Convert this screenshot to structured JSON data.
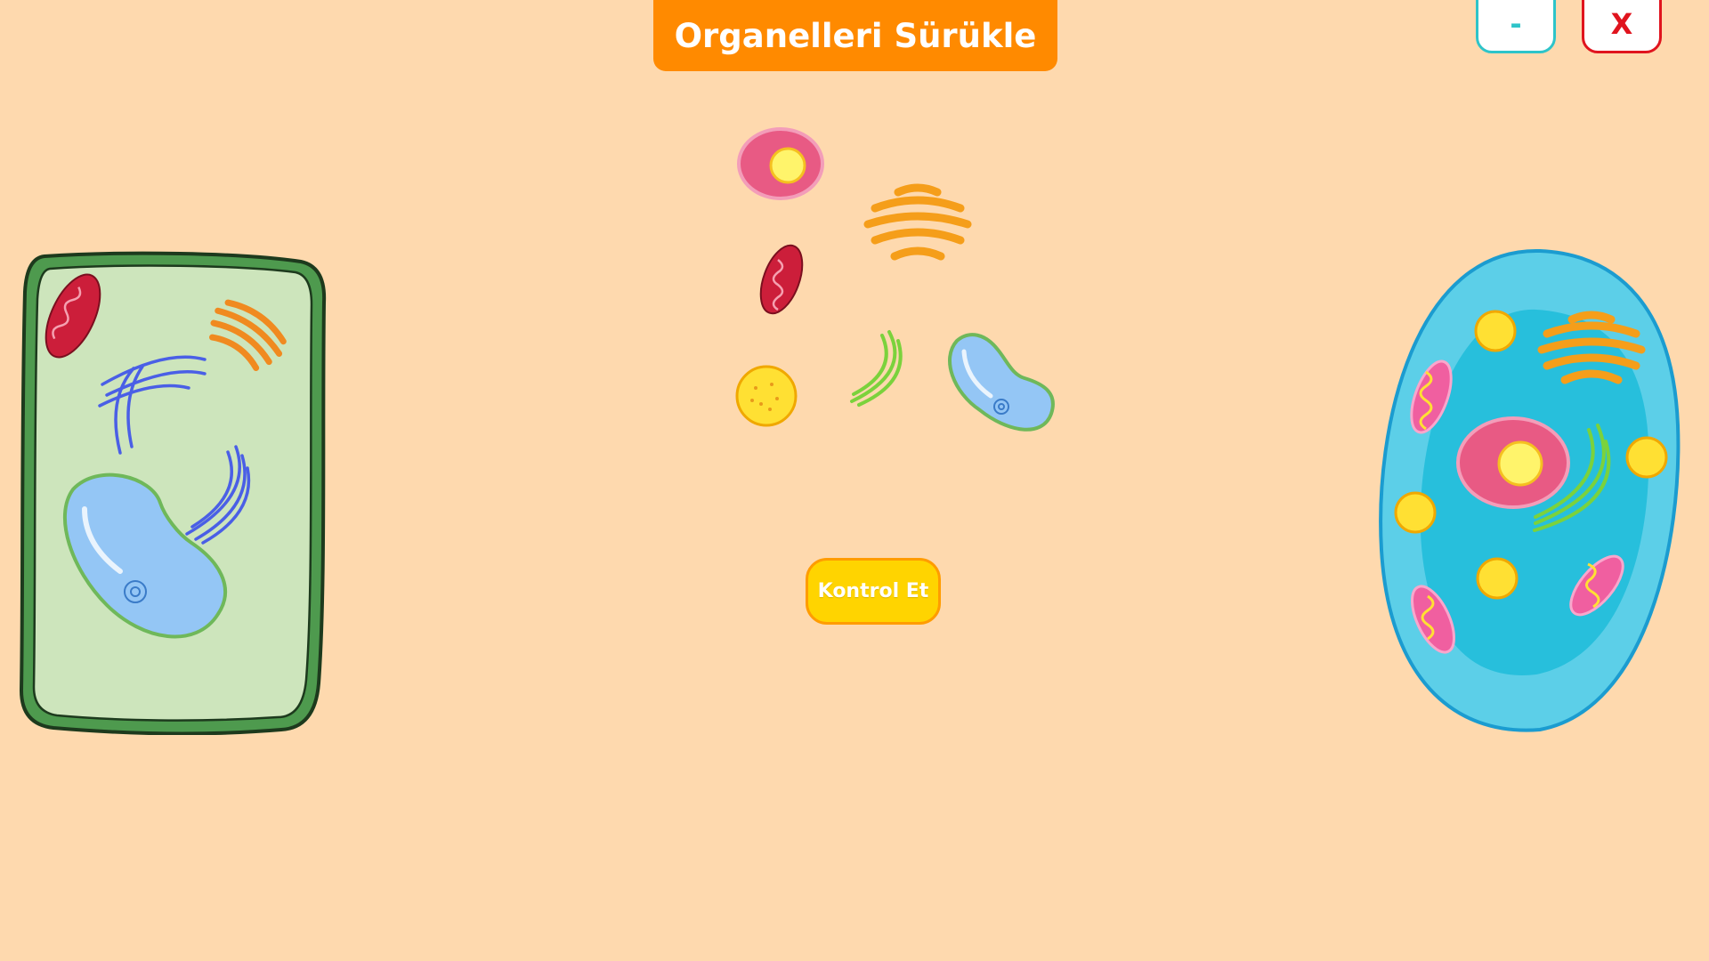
{
  "header": {
    "title": "Organelleri Sürükle"
  },
  "window_controls": {
    "minimize_label": "-",
    "close_label": "X"
  },
  "actions": {
    "check_label": "Kontrol Et"
  },
  "cells": {
    "left": "plant-cell",
    "right": "animal-cell"
  },
  "draggable_organelles": [
    "nucleus",
    "golgi-apparatus",
    "mitochondrion",
    "lysosome",
    "endoplasmic-reticulum",
    "vacuole"
  ],
  "colors": {
    "background": "#FED9AE",
    "title_bar": "#FF8A00",
    "check_button": "#FFD400",
    "minimize_border": "#2EC4C9",
    "close_border": "#E0141E"
  }
}
